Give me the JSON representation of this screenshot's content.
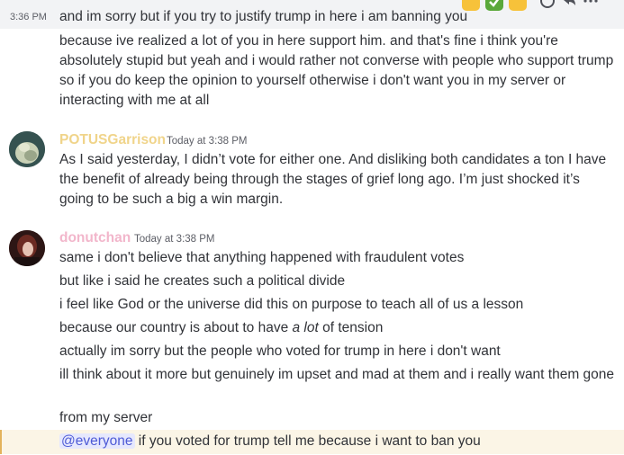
{
  "first_message": {
    "timestamp": "3:36 PM",
    "lines": [
      "and im sorry but if you try to justify trump in here i am banning you",
      "because ive realized a lot of you in here support him. and that's fine i think you're absolutely stupid but yeah and i would rather not converse with people who support trump so if you do keep the opinion to yourself otherwise i don't want you in my server or interacting with me at all"
    ]
  },
  "potus_message": {
    "username": "POTUSGarrison",
    "time": "Today at 3:38 PM",
    "username_color": "#f0d48a",
    "text": "As I said yesterday, I didn’t vote for either one. And disliking both candidates a ton I have the benefit of already being through the stages of grief long ago. I’m just shocked it’s going to be such a big a win margin."
  },
  "donut_message": {
    "username": "donutchan",
    "time": "Today at 3:38 PM",
    "username_color": "#f2b6cb",
    "lines": [
      "same i don't believe that anything happened with fraudulent votes",
      "but like i said he creates such a political divide",
      "i feel like God or the universe did this on purpose to teach all of us a lesson"
    ],
    "line4_before": "because our country is about to have ",
    "line4_italic": "a lot",
    "line4_after": " of tension",
    "lines_b": [
      "actually im sorry but the people who voted for trump in here i don't want",
      "ill think about it more but genuinely im upset and mad at them and i really want them gone",
      "from my server"
    ],
    "mention": "@everyone",
    "last_line": " if you voted for trump tell me because i want to ban you"
  },
  "toolbar": {
    "reaction_icons": [
      "thumbs-up-icon",
      "checkmark-icon",
      "clap-icon"
    ],
    "action_icons": [
      "add-reaction-icon",
      "reply-icon",
      "more-icon"
    ]
  }
}
